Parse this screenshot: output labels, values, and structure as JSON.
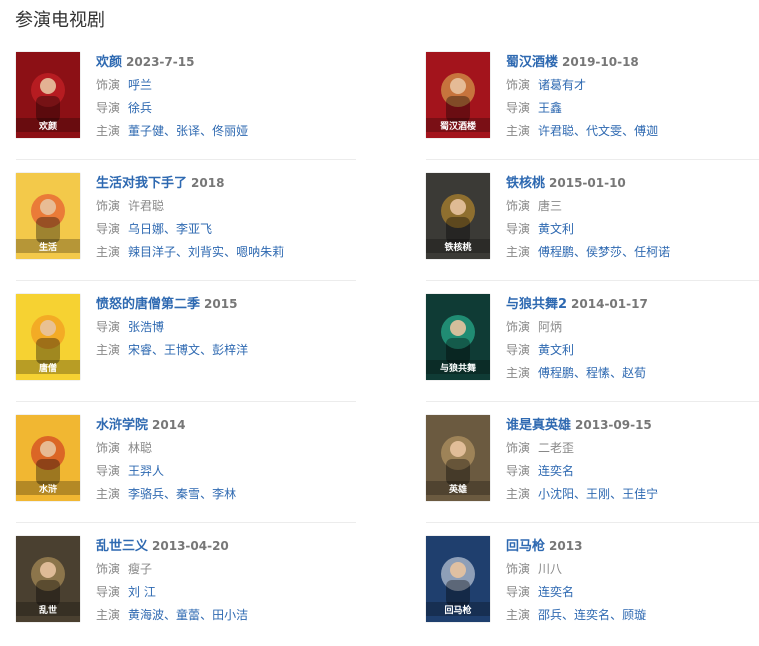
{
  "section": {
    "title": "参演电视剧"
  },
  "shows": [
    {
      "title": "欢颜",
      "date": "2023-7-15",
      "rows": [
        {
          "label": "饰演",
          "names": [
            "呼兰"
          ],
          "linked": true
        },
        {
          "label": "导演",
          "names": [
            "徐兵"
          ],
          "linked": true
        },
        {
          "label": "主演",
          "names": [
            "董子健",
            "张译",
            "佟丽娅"
          ],
          "linked": true
        }
      ],
      "poster": {
        "bg": "#8c1015",
        "accent": "#d8262b",
        "text": "欢颜"
      }
    },
    {
      "title": "蜀汉酒楼",
      "date": "2019-10-18",
      "rows": [
        {
          "label": "饰演",
          "names": [
            "诸葛有才"
          ],
          "linked": true
        },
        {
          "label": "导演",
          "names": [
            "王鑫"
          ],
          "linked": true
        },
        {
          "label": "主演",
          "names": [
            "许君聪",
            "代文雯",
            "傅迦"
          ],
          "linked": true
        }
      ],
      "poster": {
        "bg": "#a3141c",
        "accent": "#e6c25a",
        "text": "蜀汉酒楼"
      }
    },
    {
      "title": "生活对我下手了",
      "date": "2018",
      "rows": [
        {
          "label": "饰演",
          "names": [
            "许君聪"
          ],
          "linked": false
        },
        {
          "label": "导演",
          "names": [
            "乌日娜",
            "李亚飞"
          ],
          "linked": true
        },
        {
          "label": "主演",
          "names": [
            "辣目洋子",
            "刘背实",
            "嗯呐朱莉"
          ],
          "linked": true
        }
      ],
      "poster": {
        "bg": "#f3c94a",
        "accent": "#e23b2a",
        "text": "生活"
      }
    },
    {
      "title": "铁核桃",
      "date": "2015-01-10",
      "rows": [
        {
          "label": "饰演",
          "names": [
            "唐三"
          ],
          "linked": false
        },
        {
          "label": "导演",
          "names": [
            "黄文利"
          ],
          "linked": true
        },
        {
          "label": "主演",
          "names": [
            "傅程鹏",
            "侯梦莎",
            "任柯诺"
          ],
          "linked": true
        }
      ],
      "poster": {
        "bg": "#3b3a36",
        "accent": "#d69a2a",
        "text": "铁核桃"
      }
    },
    {
      "title": "愤怒的唐僧第二季",
      "date": "2015",
      "rows": [
        {
          "label": "导演",
          "names": [
            "张浩博"
          ],
          "linked": true
        },
        {
          "label": "主演",
          "names": [
            "宋睿",
            "王博文",
            "彭梓洋"
          ],
          "linked": true
        }
      ],
      "poster": {
        "bg": "#f6d232",
        "accent": "#f08a1c",
        "text": "唐僧"
      }
    },
    {
      "title": "与狼共舞2",
      "date": "2014-01-17",
      "rows": [
        {
          "label": "饰演",
          "names": [
            "阿炳"
          ],
          "linked": false
        },
        {
          "label": "导演",
          "names": [
            "黄文利"
          ],
          "linked": true
        },
        {
          "label": "主演",
          "names": [
            "傅程鹏",
            "程愫",
            "赵荀"
          ],
          "linked": true
        }
      ],
      "poster": {
        "bg": "#0f3b35",
        "accent": "#2fd0a5",
        "text": "与狼共舞"
      }
    },
    {
      "title": "水浒学院",
      "date": "2014",
      "rows": [
        {
          "label": "饰演",
          "names": [
            "林聪"
          ],
          "linked": false
        },
        {
          "label": "导演",
          "names": [
            "王羿人"
          ],
          "linked": true
        },
        {
          "label": "主演",
          "names": [
            "李骆兵",
            "秦雪",
            "李林"
          ],
          "linked": true
        }
      ],
      "poster": {
        "bg": "#f1b732",
        "accent": "#c8241d",
        "text": "水浒"
      }
    },
    {
      "title": "谁是真英雄",
      "date": "2013-09-15",
      "rows": [
        {
          "label": "饰演",
          "names": [
            "二老歪"
          ],
          "linked": false
        },
        {
          "label": "导演",
          "names": [
            "连奕名"
          ],
          "linked": true
        },
        {
          "label": "主演",
          "names": [
            "小沈阳",
            "王刚",
            "王佳宁"
          ],
          "linked": true
        }
      ],
      "poster": {
        "bg": "#6b5a40",
        "accent": "#c9a66b",
        "text": "英雄"
      }
    },
    {
      "title": "乱世三义",
      "date": "2013-04-20",
      "rows": [
        {
          "label": "饰演",
          "names": [
            "瘦子"
          ],
          "linked": false
        },
        {
          "label": "导演",
          "names": [
            "刘 江"
          ],
          "linked": true
        },
        {
          "label": "主演",
          "names": [
            "黄海波",
            "童蕾",
            "田小洁"
          ],
          "linked": true
        }
      ],
      "poster": {
        "bg": "#4a4030",
        "accent": "#c2a062",
        "text": "乱世"
      }
    },
    {
      "title": "回马枪",
      "date": "2013",
      "rows": [
        {
          "label": "饰演",
          "names": [
            "川八"
          ],
          "linked": false
        },
        {
          "label": "导演",
          "names": [
            "连奕名"
          ],
          "linked": true
        },
        {
          "label": "主演",
          "names": [
            "邵兵",
            "连奕名",
            "顾璇"
          ],
          "linked": true
        }
      ],
      "poster": {
        "bg": "#1f3f6e",
        "accent": "#e9eef5",
        "text": "回马枪"
      }
    }
  ]
}
